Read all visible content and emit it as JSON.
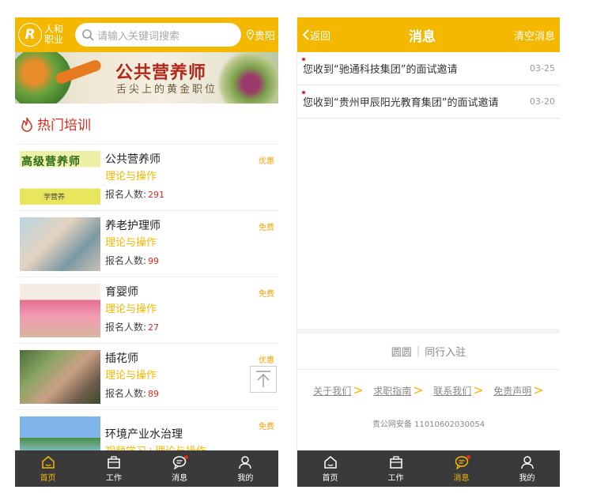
{
  "left": {
    "logo": {
      "mark": "R",
      "text": "人和职业"
    },
    "search_placeholder": "请输入关键词搜索",
    "location": "贵阳",
    "banner": {
      "title": "公共营养师",
      "subtitle": "舌尖上的黄金职位"
    },
    "section_title": "热门培训",
    "courses": [
      {
        "name": "公共营养师",
        "type": "理论与操作",
        "count_label": "报名人数:",
        "count": "291",
        "tag": "优惠",
        "thumb_text": "高级营养师",
        "thumb_footer": "学营养"
      },
      {
        "name": "养老护理师",
        "type": "理论与操作",
        "count_label": "报名人数:",
        "count": "99",
        "tag": "免费"
      },
      {
        "name": "育婴师",
        "type": "理论与操作",
        "count_label": "报名人数:",
        "count": "27",
        "tag": "免费"
      },
      {
        "name": "插花师",
        "type": "理论与操作",
        "count_label": "报名人数:",
        "count": "89",
        "tag": "优惠"
      },
      {
        "name": "环境产业水治理",
        "type": "视频学习+理论与操作",
        "tag": "免费"
      }
    ],
    "tabs": [
      {
        "label": "首页",
        "icon": "home-icon",
        "active": true
      },
      {
        "label": "工作",
        "icon": "briefcase-icon"
      },
      {
        "label": "消息",
        "icon": "chat-icon",
        "badge": true
      },
      {
        "label": "我的",
        "icon": "user-icon"
      }
    ]
  },
  "right": {
    "back_label": "返回",
    "title": "消息",
    "clear_label": "清空消息",
    "messages": [
      {
        "text": "您收到“驰通科技集团”的面试邀请",
        "date": "03-25"
      },
      {
        "text": "您收到“贵州甲辰阳光教育集团”的面试邀请",
        "date": "03-20"
      }
    ],
    "partner": {
      "a": "圆圆",
      "b": "同行入驻"
    },
    "footer_links": [
      "关于我们",
      "求职指南",
      "联系我们",
      "免责声明"
    ],
    "footer_arrow": ">",
    "icp": "贵公网安备 11010602030054",
    "tabs": [
      {
        "label": "首页",
        "icon": "home-icon"
      },
      {
        "label": "工作",
        "icon": "briefcase-icon"
      },
      {
        "label": "消息",
        "icon": "chat-icon",
        "badge": true,
        "active": true
      },
      {
        "label": "我的",
        "icon": "user-icon"
      }
    ]
  },
  "colors": {
    "accent": "#f5b800",
    "hot": "#d82c1c",
    "tabbar": "#3a3a3a"
  }
}
